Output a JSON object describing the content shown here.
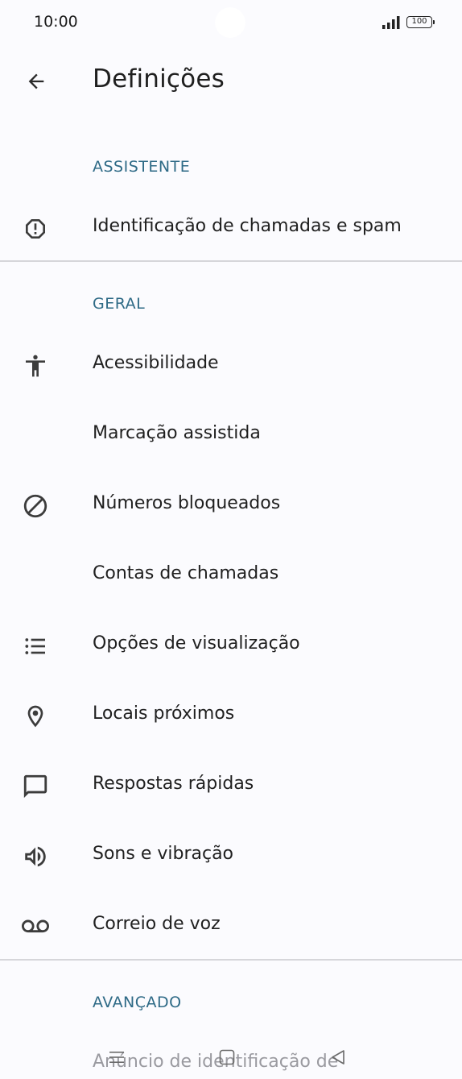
{
  "status_bar": {
    "time": "10:00",
    "battery": "100"
  },
  "app_bar": {
    "title": "Definições"
  },
  "sections": {
    "assistant": {
      "header": "ASSISTENTE",
      "items": [
        {
          "label": "Identificação de chamadas e spam",
          "icon": "alert-octagon-icon"
        }
      ]
    },
    "general": {
      "header": "GERAL",
      "items": [
        {
          "label": "Acessibilidade",
          "icon": "accessibility-icon"
        },
        {
          "label": "Marcação assistida",
          "icon": ""
        },
        {
          "label": "Números bloqueados",
          "icon": "block-icon"
        },
        {
          "label": "Contas de chamadas",
          "icon": ""
        },
        {
          "label": "Opções de visualização",
          "icon": "list-icon"
        },
        {
          "label": "Locais próximos",
          "icon": "location-pin-icon"
        },
        {
          "label": "Respostas rápidas",
          "icon": "chat-bubble-icon"
        },
        {
          "label": "Sons e vibração",
          "icon": "speaker-icon"
        },
        {
          "label": "Correio de voz",
          "icon": "voicemail-icon"
        }
      ]
    },
    "advanced": {
      "header": "AVANÇADO",
      "items": [
        {
          "label": "Anúncio de identificação de",
          "icon": ""
        }
      ]
    }
  },
  "colors": {
    "background": "#fbfbfe",
    "section_header": "#2e6a86",
    "text": "#1f1f1f",
    "icon": "#3c3c3c",
    "divider": "#d6d6da"
  }
}
